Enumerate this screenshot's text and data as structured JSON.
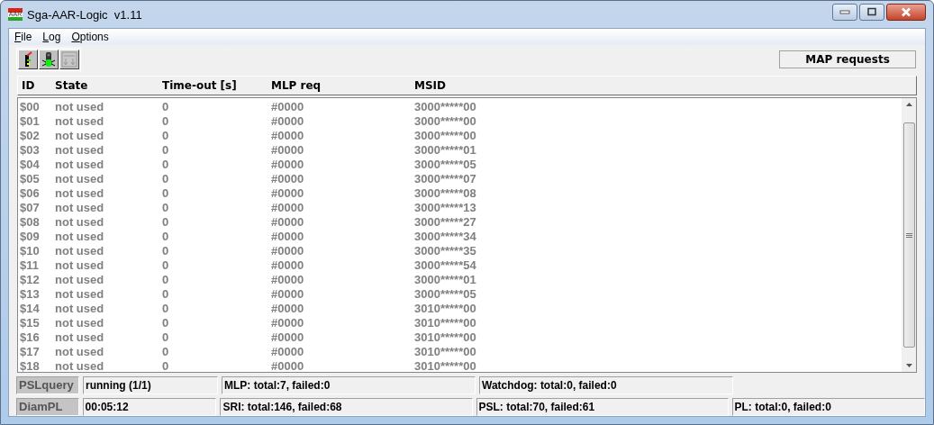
{
  "window": {
    "title": "Sga-AAR-Logic  v1.11",
    "icon_text": "AAR"
  },
  "menu": [
    "File",
    "Log",
    "Options"
  ],
  "toolbar": [
    {
      "kind": "signal",
      "disabled": false
    },
    {
      "kind": "bug",
      "disabled": false
    },
    {
      "kind": "auto",
      "disabled": true
    }
  ],
  "panel_label": "MAP requests",
  "table": {
    "columns": [
      "ID",
      "State",
      "Time-out [s]",
      "MLP req",
      "MSID"
    ],
    "rows": [
      [
        "$00",
        "not used",
        "0",
        "#0000",
        "3000*****00"
      ],
      [
        "$01",
        "not used",
        "0",
        "#0000",
        "3000*****00"
      ],
      [
        "$02",
        "not used",
        "0",
        "#0000",
        "3000*****00"
      ],
      [
        "$03",
        "not used",
        "0",
        "#0000",
        "3000*****01"
      ],
      [
        "$04",
        "not used",
        "0",
        "#0000",
        "3000*****05"
      ],
      [
        "$05",
        "not used",
        "0",
        "#0000",
        "3000*****07"
      ],
      [
        "$06",
        "not used",
        "0",
        "#0000",
        "3000*****08"
      ],
      [
        "$07",
        "not used",
        "0",
        "#0000",
        "3000*****13"
      ],
      [
        "$08",
        "not used",
        "0",
        "#0000",
        "3000*****27"
      ],
      [
        "$09",
        "not used",
        "0",
        "#0000",
        "3000*****34"
      ],
      [
        "$10",
        "not used",
        "0",
        "#0000",
        "3000*****35"
      ],
      [
        "$11",
        "not used",
        "0",
        "#0000",
        "3000*****54"
      ],
      [
        "$12",
        "not used",
        "0",
        "#0000",
        "3000*****01"
      ],
      [
        "$13",
        "not used",
        "0",
        "#0000",
        "3000*****05"
      ],
      [
        "$14",
        "not used",
        "0",
        "#0000",
        "3010*****00"
      ],
      [
        "$15",
        "not used",
        "0",
        "#0000",
        "3010*****00"
      ],
      [
        "$16",
        "not used",
        "0",
        "#0000",
        "3010*****00"
      ],
      [
        "$17",
        "not used",
        "0",
        "#0000",
        "3010*****00"
      ],
      [
        "$18",
        "not used",
        "0",
        "#0000",
        "3010*****00"
      ]
    ]
  },
  "status": [
    {
      "label": "PSLquery",
      "value": "running (1/1)",
      "stats": [
        "MLP: total:7, failed:0",
        "Watchdog: total:0, failed:0"
      ]
    },
    {
      "label": "DiamPL",
      "value": "00:05:12",
      "stats": [
        "SRI: total:146, failed:68",
        "PSL: total:70, failed:61",
        "PL: total:0, failed:0"
      ]
    }
  ]
}
